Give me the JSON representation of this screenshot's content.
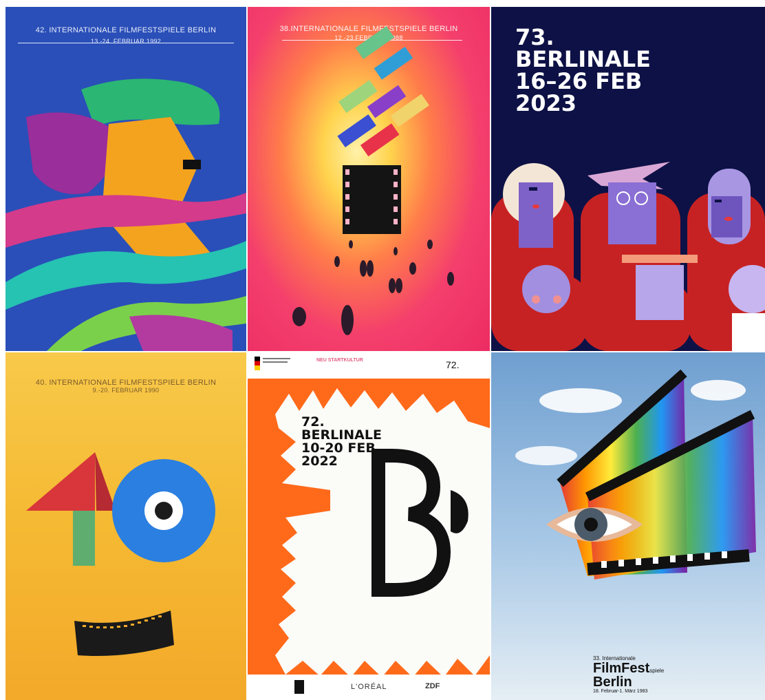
{
  "posters": [
    {
      "header_title": "42. INTERNATIONALE FILMFESTSPIELE BERLIN",
      "header_dates": "13.-24. FEBRUAR 1992"
    },
    {
      "header_title": "38.INTERNATIONALE FILMFESTSPIELE BERLIN",
      "header_dates": "12.-23.FEBRUAR 1988"
    },
    {
      "line1": "73.",
      "line2": "BERLINALE",
      "line3": "16–26 FEB",
      "line4": "2023"
    },
    {
      "header_title": "40. INTERNATIONALE FILMFESTSPIELE BERLIN",
      "header_dates": "9.-20. FEBRUAR 1990"
    },
    {
      "line1": "72.",
      "line2": "BERLINALE",
      "line3": "10-20 FEB",
      "line4": "2022",
      "badge": "72.",
      "letter": "B",
      "sponsor_1": "L'ORÉAL",
      "sponsor_2": "ZDF",
      "neustart": "NEU STARTKULTUR"
    },
    {
      "line1": "33. Internationale",
      "line2": "FilmFest",
      "line2_suffix": "spiele",
      "line3": "Berlin",
      "line4": "18. Februar-1. März 1983"
    }
  ],
  "colors": {
    "p1_bg": "#2a4fb8",
    "p2_bg": "#ec2c63",
    "p3_bg": "#0d1145",
    "p4_bg": "#f5b932",
    "p5_orange": "#ff6a1a",
    "p6_sky": "#8ab5de"
  }
}
